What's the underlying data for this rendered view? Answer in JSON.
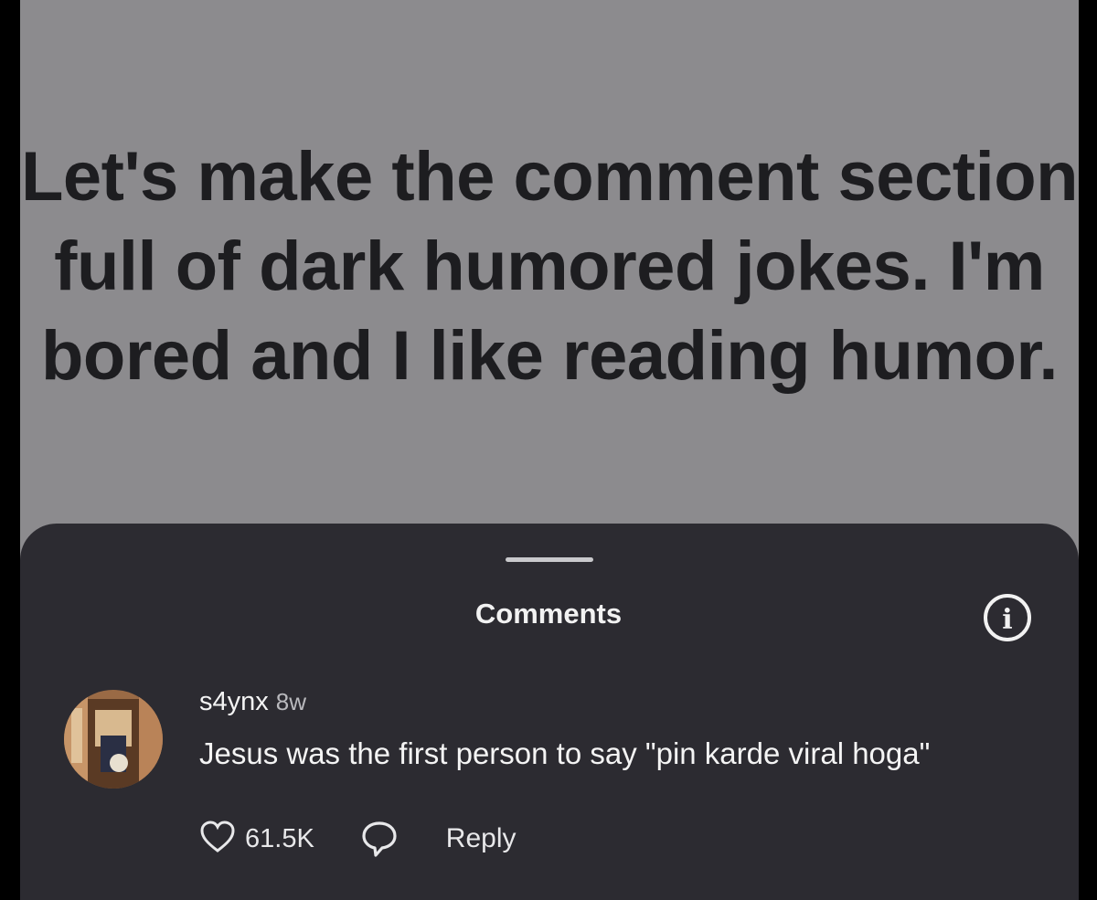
{
  "post": {
    "text": "Let's make the comment section full of dark humored jokes. I'm bored and I like reading humor."
  },
  "comments_sheet": {
    "title": "Comments",
    "info_icon": "info-icon"
  },
  "comment": {
    "username": "s4ynx",
    "time": "8w",
    "text": "Jesus was the first person to say \"pin karde viral hoga\"",
    "likes": "61.5K",
    "reply_label": "Reply",
    "icons": [
      "heart-icon",
      "reply-icon"
    ]
  },
  "colors": {
    "post_background": "#8c8b8e",
    "sheet_background": "#2c2b31",
    "text_light": "#f4f4f4"
  }
}
